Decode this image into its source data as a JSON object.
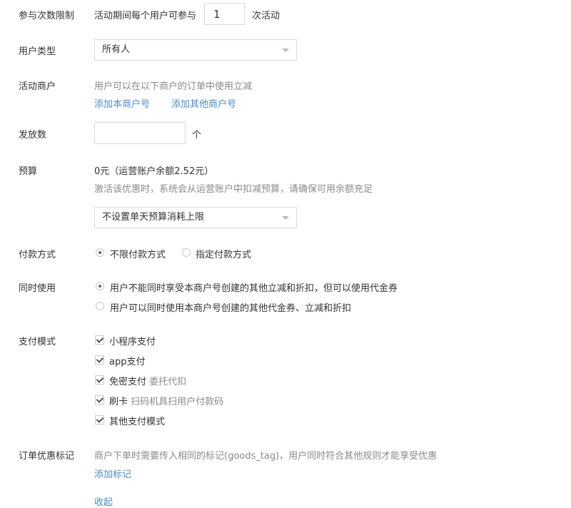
{
  "participation": {
    "label": "参与次数限制",
    "prefix": "活动期间每个用户可参与",
    "value": "1",
    "suffix": "次活动"
  },
  "user_type": {
    "label": "用户类型",
    "selected": "所有人"
  },
  "merchants": {
    "label": "活动商户",
    "hint": "用户可以在以下商户的订单中使用立减",
    "add_own": "添加本商户号",
    "add_other": "添加其他商户号"
  },
  "quantity": {
    "label": "发放数",
    "value": "",
    "unit": "个"
  },
  "budget": {
    "label": "预算",
    "amount": "0元（运营账户余额2.52元）",
    "hint": "激活该优惠时，系统会从运营账户中扣减预算，请确保可用余额充足",
    "daily_limit_selected": "不设置单天预算消耗上限"
  },
  "payment_method": {
    "label": "付款方式",
    "options": [
      "不限付款方式",
      "指定付款方式"
    ],
    "selected_index": 0
  },
  "concurrent_use": {
    "label": "同时使用",
    "options": [
      "用户不能同时享受本商户号创建的其他立减和折扣，但可以使用代金券",
      "用户可以同时使用本商户号创建的其他代金券、立减和折扣"
    ],
    "selected_index": 0
  },
  "pay_mode": {
    "label": "支付模式",
    "items": [
      {
        "label": "小程序支付",
        "note": ""
      },
      {
        "label": "app支付",
        "note": ""
      },
      {
        "label": "免密支付",
        "note": "委托代扣"
      },
      {
        "label": "刷卡",
        "note": "扫码机具扫用户付款码"
      },
      {
        "label": "其他支付模式",
        "note": ""
      }
    ]
  },
  "order_tag": {
    "label": "订单优惠标记",
    "hint": "商户下单时需要传入相同的标记(goods_tag)，用户同时符合其他规则才能享受优惠",
    "add": "添加标记"
  },
  "collapse": "收起"
}
